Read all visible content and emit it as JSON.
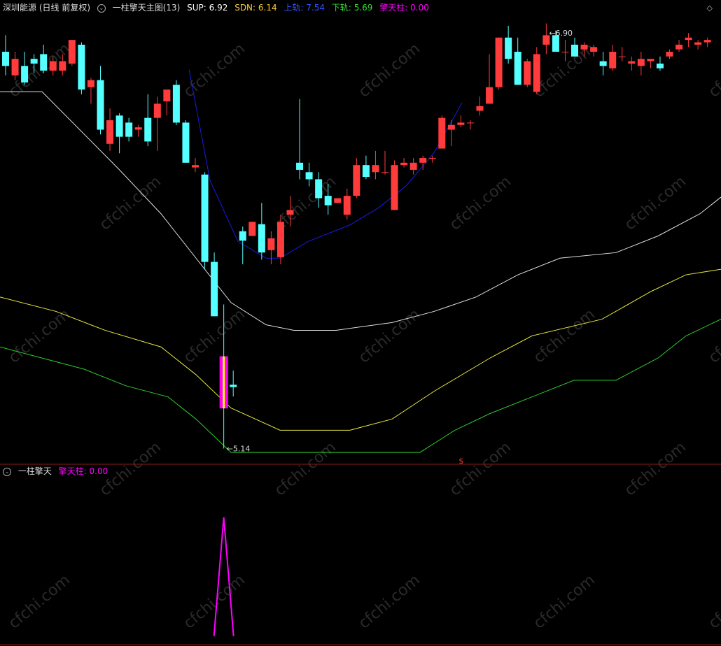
{
  "top_header": {
    "stock_name": "深圳能源",
    "period": "(日线 前复权)",
    "indicator": "一柱擎天主图(13)",
    "sup": "SUP: 6.92",
    "sdn": "SDN: 6.14",
    "upper": "上轨: 7.54",
    "lower": "下轨: 5.69",
    "pillar": "擎天柱: 0.00"
  },
  "sub_header": {
    "indicator": "一柱擎天",
    "pillar": "擎天柱: 0.00"
  },
  "colors": {
    "up": "#FF3B3B",
    "down": "#54FFFF",
    "white_line": "#E0E0E0",
    "yellow_line": "#E6E640",
    "green_line": "#2ECC2E",
    "blue_line": "#1A1AE6",
    "magenta": "#FF00FF",
    "divider": "#8B1A1A",
    "sup_color": "#FFFFFF",
    "sdn_color": "#FFCC33",
    "upper_color": "#3355FF",
    "lower_color": "#33DD33"
  },
  "chart_data": [
    {
      "type": "candlestick",
      "y_range": [
        5.1,
        6.98
      ],
      "candles": [
        {
          "o": 6.82,
          "h": 6.89,
          "l": 6.72,
          "c": 6.76
        },
        {
          "o": 6.72,
          "h": 6.82,
          "l": 6.7,
          "c": 6.79
        },
        {
          "o": 6.76,
          "h": 6.82,
          "l": 6.68,
          "c": 6.69
        },
        {
          "o": 6.79,
          "h": 6.81,
          "l": 6.73,
          "c": 6.77
        },
        {
          "o": 6.81,
          "h": 6.85,
          "l": 6.73,
          "c": 6.74
        },
        {
          "o": 6.74,
          "h": 6.8,
          "l": 6.72,
          "c": 6.78
        },
        {
          "o": 6.74,
          "h": 6.81,
          "l": 6.72,
          "c": 6.78
        },
        {
          "o": 6.77,
          "h": 6.87,
          "l": 6.76,
          "c": 6.87
        },
        {
          "o": 6.85,
          "h": 6.86,
          "l": 6.64,
          "c": 6.66
        },
        {
          "o": 6.67,
          "h": 6.71,
          "l": 6.6,
          "c": 6.7
        },
        {
          "o": 6.7,
          "h": 6.76,
          "l": 6.47,
          "c": 6.49
        },
        {
          "o": 6.43,
          "h": 6.58,
          "l": 6.4,
          "c": 6.53
        },
        {
          "o": 6.55,
          "h": 6.56,
          "l": 6.39,
          "c": 6.46
        },
        {
          "o": 6.52,
          "h": 6.54,
          "l": 6.44,
          "c": 6.46
        },
        {
          "o": 6.49,
          "h": 6.51,
          "l": 6.46,
          "c": 6.5
        },
        {
          "o": 6.54,
          "h": 6.64,
          "l": 6.42,
          "c": 6.44
        },
        {
          "o": 6.54,
          "h": 6.63,
          "l": 6.4,
          "c": 6.6
        },
        {
          "o": 6.61,
          "h": 6.66,
          "l": 6.55,
          "c": 6.66
        },
        {
          "o": 6.68,
          "h": 6.7,
          "l": 6.51,
          "c": 6.52
        },
        {
          "o": 6.52,
          "h": 6.53,
          "l": 6.35,
          "c": 6.35
        },
        {
          "o": 6.33,
          "h": 6.37,
          "l": 6.31,
          "c": 6.34
        },
        {
          "o": 6.3,
          "h": 6.31,
          "l": 5.9,
          "c": 5.93
        },
        {
          "o": 5.93,
          "h": 5.97,
          "l": 5.7,
          "c": 5.7
        },
        {
          "o": 5.53,
          "h": 5.75,
          "l": 5.14,
          "c": 5.31
        },
        {
          "o": 5.41,
          "h": 5.47,
          "l": 5.36,
          "c": 5.4
        },
        {
          "o": 6.06,
          "h": 6.08,
          "l": 5.92,
          "c": 6.02
        },
        {
          "o": 6.04,
          "h": 6.1,
          "l": 6.04,
          "c": 6.1
        },
        {
          "o": 6.09,
          "h": 6.18,
          "l": 5.94,
          "c": 5.97
        },
        {
          "o": 5.98,
          "h": 6.06,
          "l": 5.92,
          "c": 6.03
        },
        {
          "o": 5.95,
          "h": 6.13,
          "l": 5.92,
          "c": 6.1
        },
        {
          "o": 6.13,
          "h": 6.21,
          "l": 6.08,
          "c": 6.15
        },
        {
          "o": 6.35,
          "h": 6.62,
          "l": 6.28,
          "c": 6.32
        },
        {
          "o": 6.31,
          "h": 6.35,
          "l": 6.25,
          "c": 6.28
        },
        {
          "o": 6.28,
          "h": 6.31,
          "l": 6.16,
          "c": 6.2
        },
        {
          "o": 6.21,
          "h": 6.26,
          "l": 6.13,
          "c": 6.17
        },
        {
          "o": 6.18,
          "h": 6.2,
          "l": 6.18,
          "c": 6.2
        },
        {
          "o": 6.13,
          "h": 6.24,
          "l": 6.11,
          "c": 6.21
        },
        {
          "o": 6.21,
          "h": 6.37,
          "l": 6.2,
          "c": 6.34
        },
        {
          "o": 6.34,
          "h": 6.38,
          "l": 6.28,
          "c": 6.29
        },
        {
          "o": 6.31,
          "h": 6.4,
          "l": 6.28,
          "c": 6.34
        },
        {
          "o": 6.31,
          "h": 6.4,
          "l": 6.3,
          "c": 6.31
        },
        {
          "o": 6.15,
          "h": 6.36,
          "l": 6.15,
          "c": 6.34
        },
        {
          "o": 6.34,
          "h": 6.37,
          "l": 6.33,
          "c": 6.35
        },
        {
          "o": 6.32,
          "h": 6.37,
          "l": 6.3,
          "c": 6.35
        },
        {
          "o": 6.35,
          "h": 6.38,
          "l": 6.32,
          "c": 6.37
        },
        {
          "o": 6.37,
          "h": 6.38,
          "l": 6.35,
          "c": 6.37
        },
        {
          "o": 6.41,
          "h": 6.55,
          "l": 6.41,
          "c": 6.54
        },
        {
          "o": 6.49,
          "h": 6.53,
          "l": 6.42,
          "c": 6.51
        },
        {
          "o": 6.51,
          "h": 6.55,
          "l": 6.5,
          "c": 6.52
        },
        {
          "o": 6.52,
          "h": 6.53,
          "l": 6.49,
          "c": 6.52
        },
        {
          "o": 6.57,
          "h": 6.63,
          "l": 6.55,
          "c": 6.59
        },
        {
          "o": 6.6,
          "h": 6.81,
          "l": 6.6,
          "c": 6.67
        },
        {
          "o": 6.67,
          "h": 6.88,
          "l": 6.66,
          "c": 6.88
        },
        {
          "o": 6.88,
          "h": 6.93,
          "l": 6.77,
          "c": 6.79
        },
        {
          "o": 6.82,
          "h": 6.88,
          "l": 6.68,
          "c": 6.68
        },
        {
          "o": 6.68,
          "h": 6.79,
          "l": 6.67,
          "c": 6.78
        },
        {
          "o": 6.65,
          "h": 6.84,
          "l": 6.64,
          "c": 6.81
        },
        {
          "o": 6.85,
          "h": 6.94,
          "l": 6.81,
          "c": 6.89
        },
        {
          "o": 6.89,
          "h": 6.91,
          "l": 6.82,
          "c": 6.82
        },
        {
          "o": 6.82,
          "h": 6.87,
          "l": 6.78,
          "c": 6.82
        },
        {
          "o": 6.85,
          "h": 6.88,
          "l": 6.8,
          "c": 6.8
        },
        {
          "o": 6.83,
          "h": 6.86,
          "l": 6.8,
          "c": 6.85
        },
        {
          "o": 6.82,
          "h": 6.85,
          "l": 6.8,
          "c": 6.84
        },
        {
          "o": 6.78,
          "h": 6.82,
          "l": 6.72,
          "c": 6.76
        },
        {
          "o": 6.75,
          "h": 6.85,
          "l": 6.74,
          "c": 6.82
        },
        {
          "o": 6.8,
          "h": 6.84,
          "l": 6.78,
          "c": 6.8
        },
        {
          "o": 6.77,
          "h": 6.8,
          "l": 6.74,
          "c": 6.78
        },
        {
          "o": 6.76,
          "h": 6.82,
          "l": 6.72,
          "c": 6.79
        },
        {
          "o": 6.78,
          "h": 6.79,
          "l": 6.75,
          "c": 6.79
        },
        {
          "o": 6.77,
          "h": 6.8,
          "l": 6.74,
          "c": 6.75
        },
        {
          "o": 6.8,
          "h": 6.83,
          "l": 6.79,
          "c": 6.82
        },
        {
          "o": 6.83,
          "h": 6.87,
          "l": 6.82,
          "c": 6.85
        },
        {
          "o": 6.87,
          "h": 6.9,
          "l": 6.84,
          "c": 6.88
        },
        {
          "o": 6.85,
          "h": 6.87,
          "l": 6.83,
          "c": 6.86
        },
        {
          "o": 6.86,
          "h": 6.88,
          "l": 6.84,
          "c": 6.87
        }
      ],
      "highlight_candle": {
        "index": 23,
        "o": 5.53,
        "c": 5.31
      },
      "annotations": [
        {
          "text": "5.14",
          "price": 5.14,
          "candle_index": 23
        },
        {
          "text": "6.90",
          "price": 6.9,
          "candle_index": 57
        },
        {
          "text": "$",
          "candle_index": 48
        }
      ]
    },
    {
      "type": "line",
      "name": "擎天柱",
      "peak_value": 1,
      "peak_candle_index": 23,
      "values": [
        0
      ]
    }
  ],
  "lines": {
    "white": [
      [
        0,
        -1.3
      ],
      [
        60,
        -1.3
      ],
      [
        170,
        -0.6
      ],
      [
        230,
        -0.2
      ],
      [
        280,
        0.2
      ],
      [
        330,
        0.6
      ],
      [
        380,
        0.8
      ],
      [
        420,
        0.85
      ],
      [
        480,
        0.85
      ],
      [
        560,
        0.78
      ],
      [
        620,
        0.68
      ],
      [
        680,
        0.55
      ],
      [
        740,
        0.35
      ],
      [
        800,
        0.2
      ],
      [
        880,
        0.15
      ],
      [
        940,
        0.0
      ],
      [
        1000,
        -0.2
      ],
      [
        1030,
        -0.35
      ]
    ],
    "yellow": [
      [
        0,
        0.55
      ],
      [
        80,
        0.68
      ],
      [
        150,
        0.85
      ],
      [
        230,
        1.0
      ],
      [
        280,
        1.25
      ],
      [
        330,
        1.55
      ],
      [
        400,
        1.75
      ],
      [
        500,
        1.75
      ],
      [
        560,
        1.65
      ],
      [
        620,
        1.4
      ],
      [
        700,
        1.1
      ],
      [
        760,
        0.9
      ],
      [
        860,
        0.75
      ],
      [
        930,
        0.5
      ],
      [
        980,
        0.35
      ],
      [
        1030,
        0.3
      ]
    ],
    "green": [
      [
        0,
        1.0
      ],
      [
        60,
        1.1
      ],
      [
        120,
        1.2
      ],
      [
        180,
        1.35
      ],
      [
        240,
        1.45
      ],
      [
        280,
        1.65
      ],
      [
        330,
        1.95
      ],
      [
        600,
        1.95
      ],
      [
        650,
        1.75
      ],
      [
        700,
        1.6
      ],
      [
        760,
        1.45
      ],
      [
        820,
        1.3
      ],
      [
        880,
        1.3
      ],
      [
        940,
        1.1
      ],
      [
        980,
        0.9
      ],
      [
        1030,
        0.75
      ]
    ],
    "blue": [
      [
        270,
        -1.5
      ],
      [
        300,
        -0.5
      ],
      [
        340,
        0.05
      ],
      [
        380,
        0.2
      ],
      [
        400,
        0.2
      ],
      [
        440,
        0.05
      ],
      [
        500,
        -0.1
      ],
      [
        540,
        -0.25
      ],
      [
        580,
        -0.45
      ],
      [
        620,
        -0.75
      ],
      [
        660,
        -1.2
      ]
    ]
  }
}
